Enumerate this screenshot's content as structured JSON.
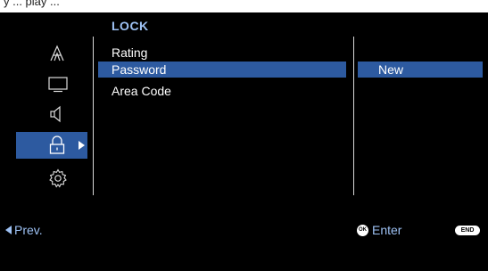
{
  "top_caption": "y   ...   play ...",
  "section_title": "LOCK",
  "side_icons": [
    {
      "name": "font-icon",
      "glyph": "𝔸"
    },
    {
      "name": "display-icon"
    },
    {
      "name": "speaker-icon"
    },
    {
      "name": "lock-icon",
      "active": true
    },
    {
      "name": "gear-icon"
    }
  ],
  "menu": {
    "items": [
      {
        "label": "Rating"
      },
      {
        "label": "Password"
      },
      {
        "label": "Area Code"
      }
    ],
    "selected_label": "Password"
  },
  "submenu": {
    "item_label": "New"
  },
  "footer": {
    "prev_label": "Prev.",
    "ok_badge": "OK",
    "enter_label": "Enter",
    "end_badge": "END"
  },
  "colors": {
    "accent": "#9dc1f3",
    "highlight": "#2d5aa0",
    "background": "#000000",
    "text": "#ffffff"
  }
}
